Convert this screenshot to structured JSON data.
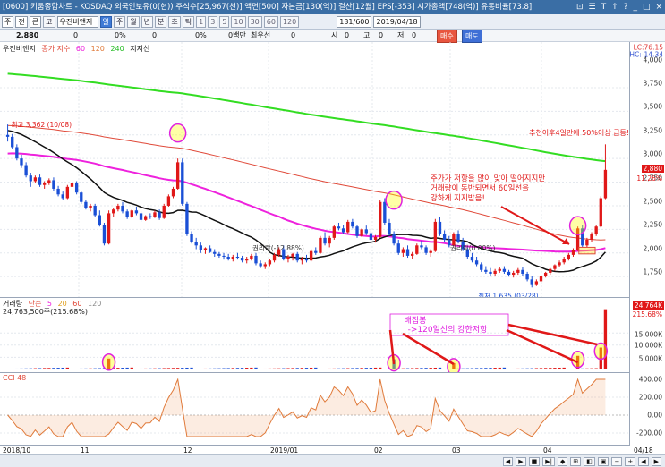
{
  "window": {
    "title": "[0600] 키움종합차트 - KOSDAQ 외국인보유(0(현)) 주식수[25,967(천)] 액면[500] 자본금[130(억)] 결산[12월] EPS[-353] 시가총액[748(억)] 유통비율[73.8]",
    "controls": [
      "⊡",
      "☰",
      "T",
      "↑",
      "?",
      "_",
      "□",
      "×"
    ]
  },
  "toolbar": {
    "code_value": "주",
    "market_value": "전",
    "mode_value": "큰",
    "ticker_button": "코",
    "stock_name": "우진비앤지",
    "period_buttons": [
      "일",
      "주",
      "월",
      "년",
      "분",
      "초",
      "틱"
    ],
    "active_period": "일",
    "interval_buttons": [
      "1",
      "3",
      "5",
      "10",
      "30",
      "60",
      "120"
    ],
    "count_value": "131/600",
    "date_value": "2019/04/18"
  },
  "quotebar": {
    "price": "2,880",
    "fields": [
      "0",
      "0%",
      "0",
      "0%",
      "0백만",
      "최우선",
      "0",
      "시",
      "0",
      "고",
      "0",
      "저",
      "0"
    ],
    "buy_label": "매수",
    "sell_label": "매도"
  },
  "price_pane": {
    "legend_name": "우진비앤지",
    "legend_ma_label": "종가 지수",
    "legend_ma": [
      "60",
      "120",
      "240"
    ],
    "legend_support": "지지선",
    "lc_label": "LC:76.15",
    "hc_label": "HC:-14.34",
    "current_badge": "2,880",
    "current_pct": "11.26%",
    "y_ticks": [
      "4,000",
      "3,750",
      "3,500",
      "3,250",
      "3,000",
      "2,750",
      "2,500",
      "2,250",
      "2,000",
      "1,750"
    ],
    "high_label": "최고 3,362 (10/08)",
    "low_label": "최저 1,635 (03/28)",
    "rights_label": "권리락(-12.88%)",
    "rights2_label": "권리락(0.00%)",
    "note1": "추천이후4일만에 50%이상 급등!",
    "note2_lines": [
      "주가가 저항을 많이 맞아 떨어지지만",
      "거래량이 동반되면서 60일선을",
      "강하게 지지받음!"
    ],
    "colors": {
      "ma60": "#ee22dd",
      "ma120": "#e04a3a",
      "ma240": "#33dd22",
      "support": "#111111",
      "up": "#e01818",
      "down": "#1a4fd6"
    }
  },
  "volume_pane": {
    "legend_label": "거래량",
    "legend_sub": "단순",
    "legend_ma": [
      "5",
      "20",
      "60",
      "120"
    ],
    "current_volume": "24,763,500주(215.68%)",
    "badge": "24,764K",
    "badge_pct": "215.68%",
    "y_ticks": [
      "20,000K",
      "15,000K",
      "10,000K",
      "5,000K"
    ],
    "annotation_lines": [
      "배집봉",
      "->120일선의 강한저항"
    ]
  },
  "cci_pane": {
    "legend_label": "CCI 48",
    "y_ticks": [
      "400.00",
      "200.00",
      "0.00",
      "-200.00"
    ]
  },
  "date_axis": {
    "labels": [
      "2018/10",
      "11",
      "12",
      "2019/01",
      "02",
      "03",
      "04",
      "04/18"
    ]
  },
  "statusbar": {
    "buttons": [
      "◀",
      "▶",
      "■",
      "▶|",
      "◆",
      "⊞",
      "◧",
      "▣",
      "−",
      "+",
      "◀",
      "▶"
    ]
  },
  "chart_data": {
    "type": "candlestick",
    "x_range": [
      "2018/10",
      "2019/04/18"
    ],
    "ylim": [
      1600,
      4100
    ],
    "annotated_high": {
      "date": "10/08",
      "value": 3362
    },
    "annotated_low": {
      "date": "03/28",
      "value": 1635
    },
    "last_close": 2880,
    "candles": [
      [
        3250,
        3360,
        3180,
        3230
      ],
      [
        3230,
        3260,
        3100,
        3120
      ],
      [
        3120,
        3150,
        2980,
        3000
      ],
      [
        3000,
        3040,
        2900,
        2930
      ],
      [
        2930,
        2960,
        2800,
        2820
      ],
      [
        2820,
        2850,
        2700,
        2760
      ],
      [
        2760,
        2820,
        2740,
        2800
      ],
      [
        2800,
        2830,
        2700,
        2720
      ],
      [
        2720,
        2760,
        2680,
        2740
      ],
      [
        2740,
        2790,
        2720,
        2770
      ],
      [
        2770,
        2800,
        2660,
        2680
      ],
      [
        2680,
        2710,
        2600,
        2620
      ],
      [
        2620,
        2650,
        2560,
        2580
      ],
      [
        2580,
        2720,
        2570,
        2700
      ],
      [
        2700,
        2760,
        2680,
        2740
      ],
      [
        2740,
        2760,
        2620,
        2640
      ],
      [
        2640,
        2660,
        2520,
        2540
      ],
      [
        2540,
        2560,
        2460,
        2480
      ],
      [
        2480,
        2520,
        2440,
        2500
      ],
      [
        2500,
        2520,
        2380,
        2400
      ],
      [
        2400,
        2450,
        2280,
        2300
      ],
      [
        2300,
        2320,
        2080,
        2100
      ],
      [
        2100,
        2450,
        2090,
        2420
      ],
      [
        2420,
        2480,
        2380,
        2460
      ],
      [
        2460,
        2520,
        2440,
        2500
      ],
      [
        2500,
        2540,
        2420,
        2440
      ],
      [
        2440,
        2460,
        2360,
        2380
      ],
      [
        2380,
        2460,
        2370,
        2450
      ],
      [
        2450,
        2490,
        2400,
        2420
      ],
      [
        2420,
        2440,
        2330,
        2350
      ],
      [
        2350,
        2400,
        2340,
        2390
      ],
      [
        2390,
        2420,
        2360,
        2380
      ],
      [
        2380,
        2450,
        2370,
        2430
      ],
      [
        2430,
        2460,
        2350,
        2370
      ],
      [
        2370,
        2520,
        2360,
        2500
      ],
      [
        2500,
        2620,
        2490,
        2600
      ],
      [
        2600,
        2700,
        2580,
        2680
      ],
      [
        2680,
        3000,
        2670,
        2960
      ],
      [
        2960,
        3000,
        2500,
        2520
      ],
      [
        2520,
        2540,
        2180,
        2200
      ],
      [
        2200,
        2230,
        2100,
        2120
      ],
      [
        2120,
        2160,
        2040,
        2080
      ],
      [
        2080,
        2110,
        2000,
        2030
      ],
      [
        2030,
        2060,
        1990,
        2050
      ],
      [
        2050,
        2080,
        2000,
        2010
      ],
      [
        2010,
        2040,
        1960,
        1990
      ],
      [
        1990,
        2010,
        1950,
        1970
      ],
      [
        1970,
        2000,
        1930,
        1960
      ],
      [
        1960,
        1990,
        1920,
        1940
      ],
      [
        1940,
        1980,
        1910,
        1960
      ],
      [
        1960,
        2000,
        1930,
        1950
      ],
      [
        1950,
        1970,
        1900,
        1920
      ],
      [
        1920,
        1960,
        1890,
        1940
      ],
      [
        1940,
        1990,
        1920,
        1970
      ],
      [
        1970,
        2000,
        1870,
        1890
      ],
      [
        1890,
        1920,
        1840,
        1860
      ],
      [
        1860,
        1900,
        1830,
        1880
      ],
      [
        1880,
        1940,
        1860,
        1920
      ],
      [
        1920,
        2000,
        1900,
        1980
      ],
      [
        1980,
        2060,
        1960,
        2040
      ],
      [
        2040,
        2080,
        1920,
        1940
      ],
      [
        1940,
        1980,
        1900,
        1960
      ],
      [
        1960,
        2000,
        1920,
        1990
      ],
      [
        1990,
        2010,
        1900,
        1920
      ],
      [
        1920,
        1960,
        1880,
        1940
      ],
      [
        1940,
        1980,
        1900,
        1920
      ],
      [
        1920,
        2040,
        1910,
        2020
      ],
      [
        2020,
        2060,
        1980,
        2000
      ],
      [
        2000,
        2180,
        1990,
        2160
      ],
      [
        2160,
        2220,
        2080,
        2100
      ],
      [
        2100,
        2180,
        2060,
        2160
      ],
      [
        2160,
        2300,
        2140,
        2280
      ],
      [
        2280,
        2320,
        2240,
        2260
      ],
      [
        2260,
        2300,
        2200,
        2220
      ],
      [
        2220,
        2350,
        2210,
        2330
      ],
      [
        2330,
        2360,
        2260,
        2280
      ],
      [
        2280,
        2300,
        2160,
        2180
      ],
      [
        2180,
        2260,
        2170,
        2250
      ],
      [
        2250,
        2290,
        2190,
        2210
      ],
      [
        2210,
        2240,
        2120,
        2140
      ],
      [
        2140,
        2190,
        2110,
        2170
      ],
      [
        2170,
        2560,
        2160,
        2540
      ],
      [
        2540,
        2580,
        2300,
        2320
      ],
      [
        2320,
        2360,
        2180,
        2200
      ],
      [
        2200,
        2230,
        2080,
        2100
      ],
      [
        2100,
        2140,
        1980,
        2000
      ],
      [
        2000,
        2060,
        1960,
        2040
      ],
      [
        2040,
        2080,
        1950,
        1970
      ],
      [
        1970,
        2010,
        1940,
        1990
      ],
      [
        1990,
        2100,
        1980,
        2080
      ],
      [
        2080,
        2130,
        2040,
        2060
      ],
      [
        2060,
        2080,
        1980,
        2000
      ],
      [
        2000,
        2040,
        1960,
        2020
      ],
      [
        2020,
        2360,
        2010,
        2330
      ],
      [
        2330,
        2380,
        2180,
        2200
      ],
      [
        2200,
        2240,
        2120,
        2140
      ],
      [
        2140,
        2180,
        2060,
        2080
      ],
      [
        2080,
        2220,
        2070,
        2200
      ],
      [
        2200,
        2240,
        2100,
        2120
      ],
      [
        2120,
        2160,
        2020,
        2040
      ],
      [
        2040,
        2060,
        1940,
        1960
      ],
      [
        1960,
        2000,
        1900,
        1920
      ],
      [
        1920,
        1960,
        1860,
        1880
      ],
      [
        1880,
        1900,
        1800,
        1820
      ],
      [
        1820,
        1860,
        1780,
        1800
      ],
      [
        1800,
        1840,
        1760,
        1780
      ],
      [
        1780,
        1830,
        1760,
        1810
      ],
      [
        1810,
        1850,
        1790,
        1830
      ],
      [
        1830,
        1860,
        1780,
        1800
      ],
      [
        1800,
        1820,
        1750,
        1770
      ],
      [
        1770,
        1810,
        1740,
        1790
      ],
      [
        1790,
        1840,
        1770,
        1820
      ],
      [
        1820,
        1850,
        1760,
        1780
      ],
      [
        1780,
        1800,
        1700,
        1720
      ],
      [
        1720,
        1760,
        1635,
        1660
      ],
      [
        1660,
        1720,
        1650,
        1700
      ],
      [
        1700,
        1780,
        1690,
        1760
      ],
      [
        1760,
        1800,
        1740,
        1790
      ],
      [
        1790,
        1840,
        1770,
        1830
      ],
      [
        1830,
        1880,
        1810,
        1870
      ],
      [
        1870,
        1920,
        1850,
        1900
      ],
      [
        1900,
        1960,
        1880,
        1940
      ],
      [
        1940,
        2000,
        1920,
        1980
      ],
      [
        1980,
        2050,
        1960,
        2030
      ],
      [
        2030,
        2280,
        2020,
        2260
      ],
      [
        2260,
        2300,
        2060,
        2080
      ],
      [
        2080,
        2160,
        2060,
        2140
      ],
      [
        2140,
        2220,
        2120,
        2200
      ],
      [
        2200,
        2300,
        2180,
        2280
      ],
      [
        2280,
        2600,
        2270,
        2580
      ],
      [
        2580,
        3150,
        2570,
        2880
      ]
    ],
    "volume_spikes_k": [
      {
        "index": 22,
        "value": 4500
      },
      {
        "index": 84,
        "value": 4200
      },
      {
        "index": 97,
        "value": 2600
      },
      {
        "index": 124,
        "value": 5600
      },
      {
        "index": 129,
        "value": 9000
      },
      {
        "index": 130,
        "value": 24764
      }
    ],
    "cci_last": 400
  }
}
